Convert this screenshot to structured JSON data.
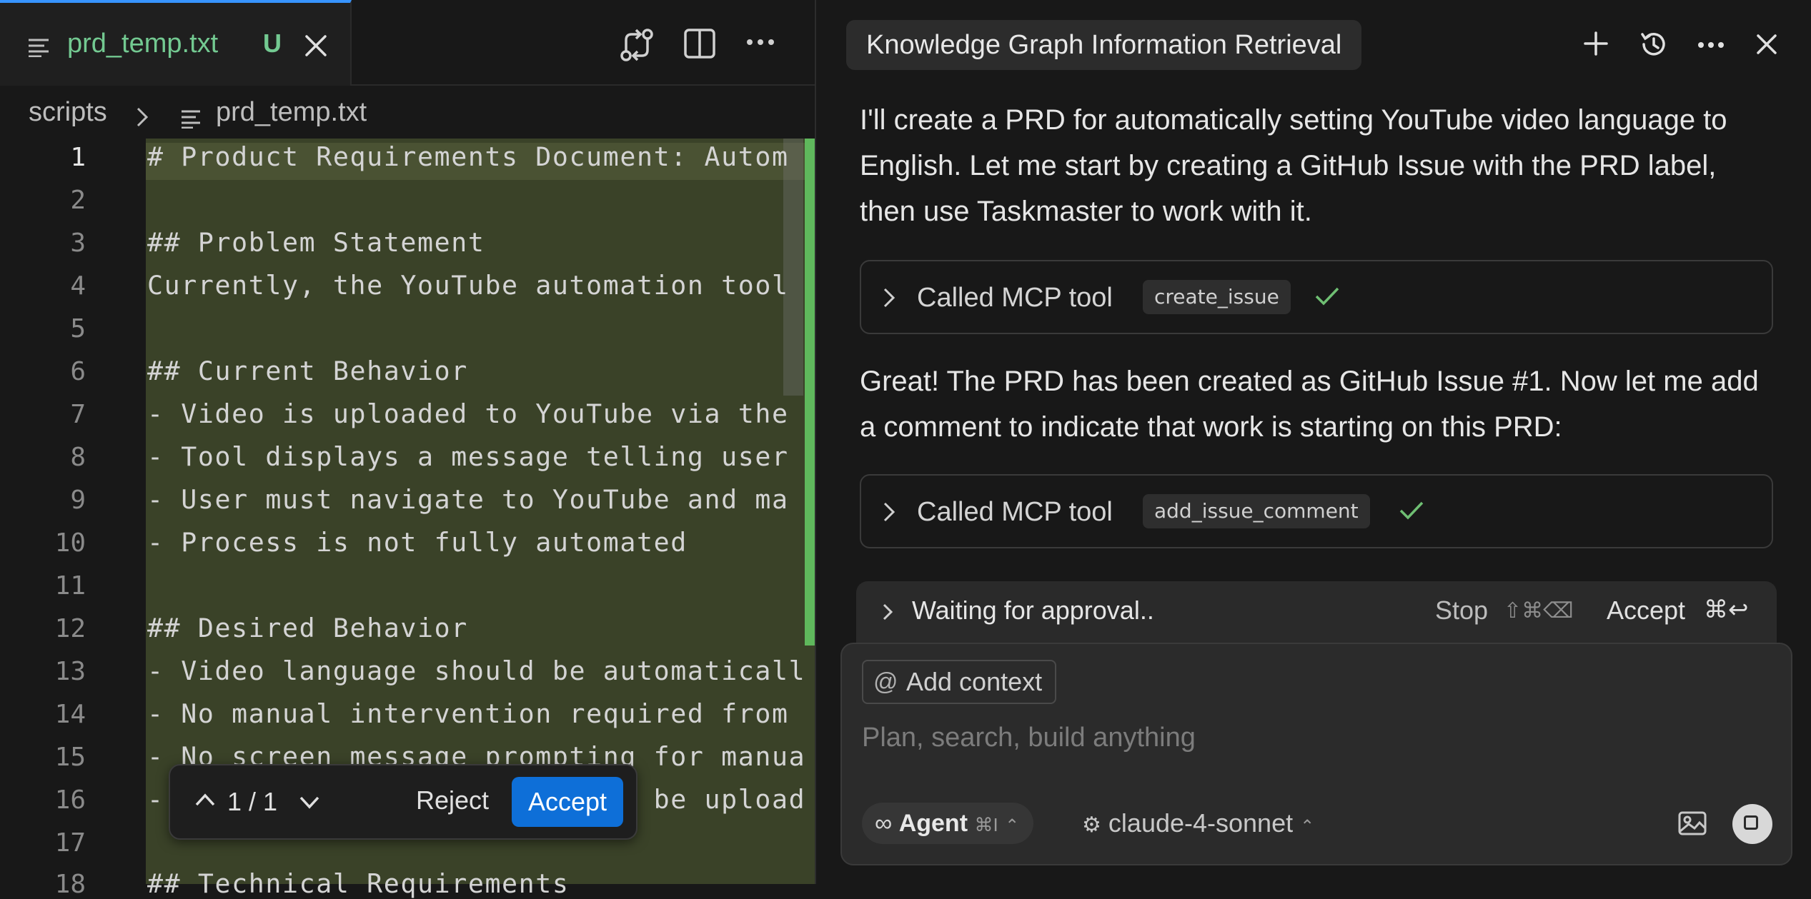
{
  "editor": {
    "tab_name": "prd_temp.txt",
    "tab_status": "U",
    "breadcrumb": {
      "folder": "scripts",
      "file": "prd_temp.txt"
    },
    "lines": [
      {
        "n": "1",
        "text": "# Product Requirements Document: Autom"
      },
      {
        "n": "2",
        "text": ""
      },
      {
        "n": "3",
        "text": "## Problem Statement"
      },
      {
        "n": "4",
        "text": "Currently, the YouTube automation tool"
      },
      {
        "n": "5",
        "text": ""
      },
      {
        "n": "6",
        "text": "## Current Behavior"
      },
      {
        "n": "7",
        "text": "- Video is uploaded to YouTube via the"
      },
      {
        "n": "8",
        "text": "- Tool displays a message telling user"
      },
      {
        "n": "9",
        "text": "- User must navigate to YouTube and ma"
      },
      {
        "n": "10",
        "text": "- Process is not fully automated"
      },
      {
        "n": "11",
        "text": ""
      },
      {
        "n": "12",
        "text": "## Desired Behavior"
      },
      {
        "n": "13",
        "text": "- Video language should be automaticall"
      },
      {
        "n": "14",
        "text": "- No manual intervention required from"
      },
      {
        "n": "15",
        "text": "- No screen message prompting for manua"
      },
      {
        "n": "16",
        "text": "- Video upload process should be upload expe"
      },
      {
        "n": "17",
        "text": ""
      },
      {
        "n": "18",
        "text": "## Technical Requirements"
      }
    ],
    "review": {
      "count": "1 / 1",
      "reject": "Reject",
      "accept": "Accept"
    }
  },
  "chat": {
    "title": "Knowledge Graph Information Retrieval",
    "messages": [
      "I'll create a PRD for automatically setting YouTube video language to English. Let me start by creating a GitHub Issue with the PRD label, then use Taskmaster to work with it.",
      "Great! The PRD has been created as GitHub Issue #1. Now let me add a comment to indicate that work is starting on this PRD:"
    ],
    "tool_calls": [
      {
        "label": "Called MCP tool",
        "tool": "create_issue"
      },
      {
        "label": "Called MCP tool",
        "tool": "add_issue_comment"
      }
    ],
    "approval": {
      "text": "Waiting for approval..",
      "stop": "Stop",
      "stop_shortcut": "⇧⌘⌫",
      "accept": "Accept",
      "accept_shortcut": "⌘↩"
    },
    "composer": {
      "add_context": "Add context",
      "placeholder": "Plan, search, build anything",
      "mode": "Agent",
      "mode_shortcut": "⌘I",
      "model": "claude-4-sonnet"
    }
  },
  "colors": {
    "accent": "#0e6fd8",
    "added_bg": "#3a4228",
    "untracked": "#73c991",
    "check": "#6fbf73"
  }
}
